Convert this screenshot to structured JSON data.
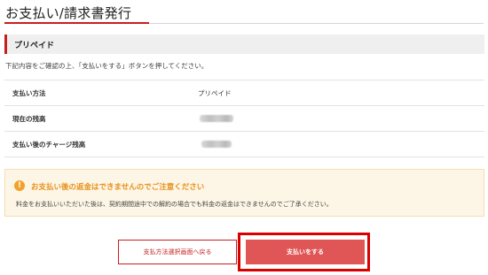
{
  "page_title": "お支払い/請求書発行",
  "section": {
    "title": "プリペイド"
  },
  "instruction": "下記内容をご確認の上、「支払いをする」ボタンを押してください。",
  "details": {
    "payment_method": {
      "label": "支払い方法",
      "value": "プリペイド"
    },
    "current_balance": {
      "label": "現在の残高",
      "value_state": "redacted"
    },
    "balance_after_charge": {
      "label": "支払い後のチャージ残高",
      "value_state": "redacted"
    }
  },
  "notice": {
    "icon": "exclamation-icon",
    "icon_glyph": "!",
    "title": "お支払い後の返金はできませんのでご注意ください",
    "body": "料金をお支払いいただいた後は、契約期間途中での解約の場合でも料金の返金はできませんのでご了承ください。",
    "accent_color": "#f2a12b"
  },
  "buttons": {
    "back_label": "支払方法選択画面へ戻る",
    "pay_label": "支払いをする"
  },
  "colors": {
    "accent": "#c81e1e",
    "pay_button": "#e05656",
    "highlight": "#d90000"
  }
}
